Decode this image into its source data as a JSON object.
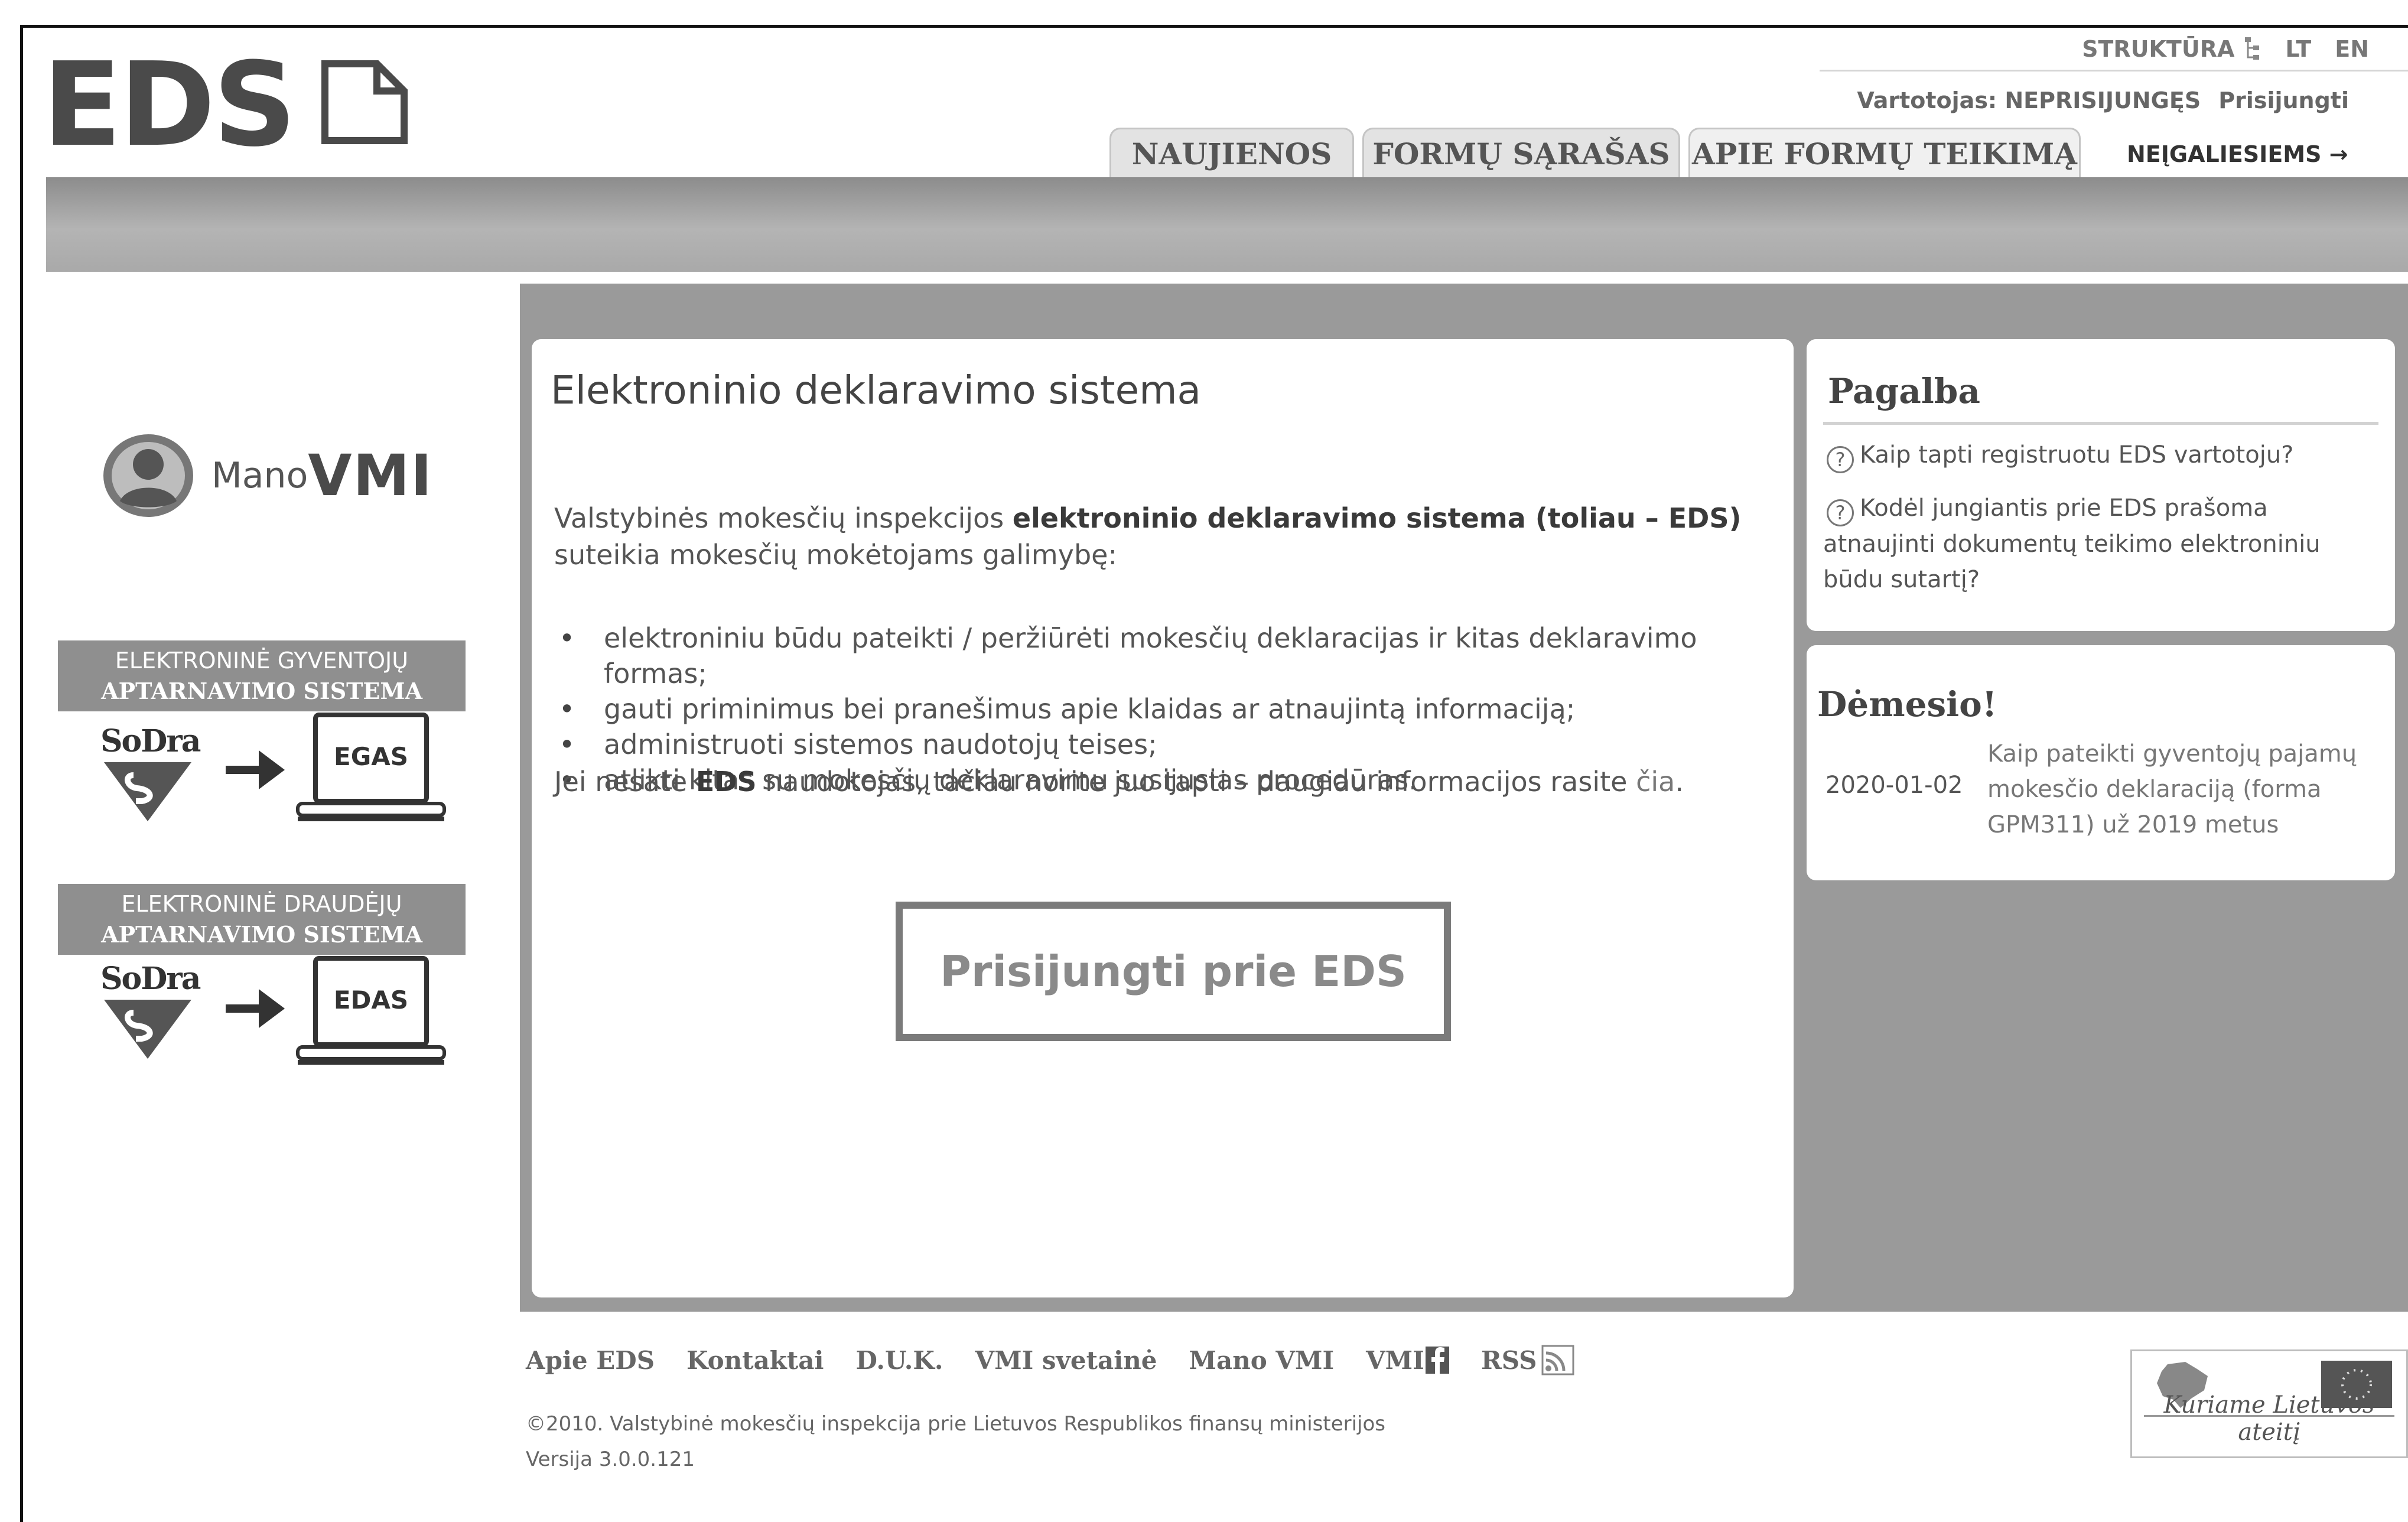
{
  "header": {
    "logo_text": "EDS",
    "util": {
      "structure": "STRUKTŪRA",
      "lang_lt": "LT",
      "lang_en": "EN"
    },
    "user": {
      "label": "Vartotojas: NEPRISIJUNGĘS",
      "login": "Prisijungti"
    },
    "tabs": [
      {
        "label": "NAUJIENOS"
      },
      {
        "label": "FORMŲ SĄRAŠAS"
      },
      {
        "label": "APIE FORMŲ TEIKIMĄ"
      }
    ],
    "disabled_link": "NEĮGALIESIEMS →"
  },
  "sidebar": {
    "mano_vmi": {
      "mano": "Mano",
      "vmi": "VMI"
    },
    "egas": {
      "title_line1": "ELEKTRONINĖ GYVENTOJŲ",
      "title_line2": "APTARNAVIMO SISTEMA",
      "sodra": "SoDra",
      "screen_label": "EGAS"
    },
    "edas": {
      "title_line1": "ELEKTRONINĖ DRAUDĖJŲ",
      "title_line2": "APTARNAVIMO SISTEMA",
      "sodra": "SoDra",
      "screen_label": "EDAS"
    }
  },
  "main": {
    "title": "Elektroninio deklaravimo sistema",
    "intro_part1": "Valstybinės mokesčių inspekcijos ",
    "intro_bold": "elektroninio deklaravimo sistema (toliau – EDS)",
    "intro_part2": " suteikia mokesčių mokėtojams galimybę:",
    "bullets": [
      "elektroniniu būdu pateikti / peržiūrėti mokesčių deklaracijas ir kitas deklaravimo formas;",
      "gauti priminimus bei pranešimus apie klaidas ar atnaujintą informaciją;",
      "administruoti sistemos naudotojų teises;",
      "atlikti kitas su mokesčių deklaravimu susijusias procedūras."
    ],
    "info_part1": "Jei nesate ",
    "info_bold": "EDS",
    "info_part2": " naudotojas, tačiau norite juo tapti – daugiau informacijos rasite ",
    "info_link": "čia",
    "info_end": ".",
    "login_button": "Prisijungti prie EDS"
  },
  "help": {
    "title": "Pagalba",
    "questions": [
      "Kaip tapti registruotu EDS vartotoju?",
      "Kodėl jungiantis prie EDS prašoma atnaujinti dokumentų teikimo elektroniniu būdu sutartį?"
    ]
  },
  "attention": {
    "title": "Dėmesio!",
    "date": "2020-01-02",
    "text": "Kaip pateikti gyventojų pajamų mokesčio deklaraciją (forma GPM311) už 2019 metus"
  },
  "footer": {
    "links": [
      "Apie EDS",
      "Kontaktai",
      "D.U.K.",
      "VMI svetainė",
      "Mano VMI",
      "VMI",
      "RSS"
    ],
    "copyright": "©2010. Valstybinė mokesčių inspekcija prie Lietuvos Respublikos finansų ministerijos",
    "version": "Versija 3.0.0.121",
    "eu_caption": "Kuriame Lietuvos ateitį"
  },
  "colors": {
    "header_band": "#a0a0a0",
    "main_background": "#9a9a9a",
    "panel": "#ffffff",
    "button_border": "#7b7b7b"
  }
}
